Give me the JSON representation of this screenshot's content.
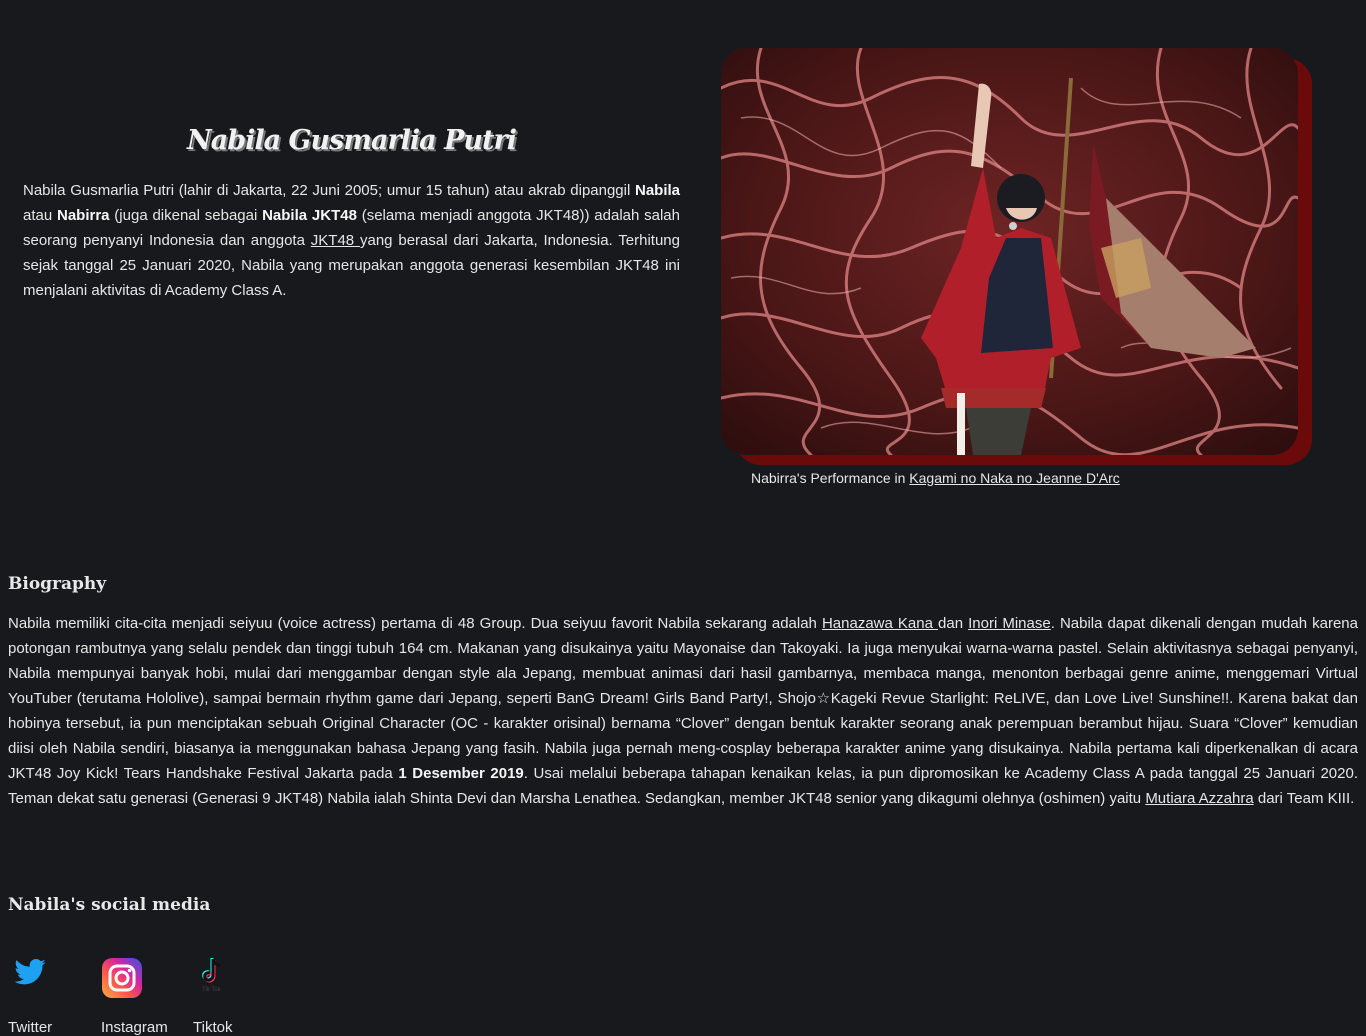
{
  "profile": {
    "name": "Nabila Gusmarlia Putri",
    "intro": {
      "p1": "Nabila Gusmarlia Putri (lahir di Jakarta, 22 Juni 2005; umur 15 tahun) atau akrab dipanggil ",
      "b1": "Nabila",
      "p2": " atau ",
      "b2": "Nabirra",
      "p3": " (juga dikenal sebagai ",
      "b3": "Nabila JKT48",
      "p4": " (selama menjadi anggota JKT48)) adalah salah seorang penyanyi Indonesia dan anggota ",
      "link": "JKT48 ",
      "p5": "yang berasal dari Jakarta, Indonesia. Terhitung sejak tanggal 25 Januari 2020, Nabila yang merupakan anggota generasi kesembilan JKT48 ini menjalani aktivitas di Academy Class A."
    }
  },
  "photo": {
    "caption_prefix": "Nabirra's Performance in ",
    "caption_link": "Kagami no Naka no Jeanne D'Arc",
    "frame_shadow_color": "#6b0a0a"
  },
  "biography": {
    "heading": "Biography",
    "t1": "Nabila memiliki cita-cita menjadi seiyuu (voice actress) pertama di 48 Group. Dua seiyuu favorit Nabila sekarang adalah ",
    "link1": "Hanazawa Kana ",
    "t2": "dan ",
    "link2": "Inori Minase",
    "t3": ". Nabila dapat dikenali dengan mudah karena potongan rambutnya yang selalu pendek dan tinggi tubuh 164 cm. Makanan yang disukainya yaitu Mayonaise dan Takoyaki. Ia juga menyukai warna-warna pastel. Selain aktivitasnya sebagai penyanyi, Nabila mempunyai banyak hobi, mulai dari menggambar dengan style ala Jepang, membuat animasi dari hasil gambarnya, membaca manga, menonton berbagai genre anime, menggemari Virtual YouTuber (terutama Hololive), sampai bermain rhythm game dari Jepang, seperti BanG Dream! Girls Band Party!, Shojo☆Kageki Revue Starlight: ReLIVE, dan Love Live! Sunshine!!. Karena bakat dan hobinya tersebut, ia pun menciptakan sebuah Original Character (OC - karakter orisinal) bernama “Clover” dengan bentuk karakter seorang anak perempuan berambut hijau. Suara “Clover” kemudian diisi oleh Nabila sendiri, biasanya ia menggunakan bahasa Jepang yang fasih. Nabila juga pernah meng-cosplay beberapa karakter anime yang disukainya. Nabila pertama kali diperkenalkan di acara JKT48 Joy Kick! Tears Handshake Festival Jakarta pada ",
    "bold_date": "1 Desember 2019",
    "t4": ". Usai melalui beberapa tahapan kenaikan kelas, ia pun dipromosikan ke Academy Class A pada tanggal 25 Januari 2020. Teman dekat satu generasi (Generasi 9 JKT48) Nabila ialah Shinta Devi dan Marsha Lenathea. Sedangkan, member JKT48 senior yang dikagumi olehnya (oshimen) yaitu ",
    "link3": "Mutiara Azzahra",
    "t5": " dari Team KIII."
  },
  "social": {
    "heading": "Nabila's social media",
    "items": [
      {
        "label": "Twitter",
        "icon": "twitter-icon",
        "color": "#1da1f2"
      },
      {
        "label": "Instagram",
        "icon": "instagram-icon",
        "color": "#e1306c"
      },
      {
        "label": "Tiktok",
        "icon": "tiktok-icon",
        "color": "#111111",
        "icon_caption": "Tik Tok"
      }
    ]
  }
}
